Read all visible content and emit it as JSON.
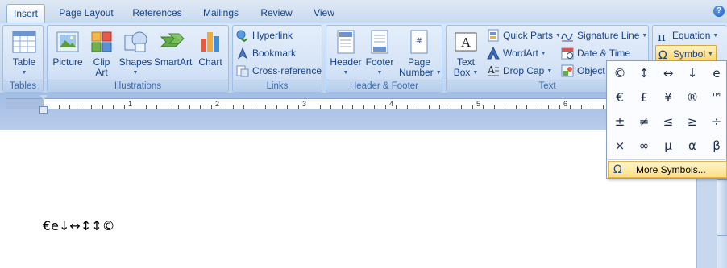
{
  "tabs": [
    {
      "label": "Insert",
      "active": true
    },
    {
      "label": "Page Layout"
    },
    {
      "label": "References"
    },
    {
      "label": "Mailings"
    },
    {
      "label": "Review"
    },
    {
      "label": "View"
    }
  ],
  "help_label": "?",
  "groups": {
    "tables": {
      "label": "Tables",
      "table_label": "Table"
    },
    "illustrations": {
      "label": "Illustrations",
      "picture": "Picture",
      "clip_art_1": "Clip",
      "clip_art_2": "Art",
      "shapes": "Shapes",
      "smartart": "SmartArt",
      "chart": "Chart"
    },
    "links": {
      "label": "Links",
      "hyperlink": "Hyperlink",
      "bookmark": "Bookmark",
      "cross_reference": "Cross-reference"
    },
    "header_footer": {
      "label": "Header & Footer",
      "header": "Header",
      "footer": "Footer",
      "page_number_1": "Page",
      "page_number_2": "Number"
    },
    "text": {
      "label": "Text",
      "text_box_1": "Text",
      "text_box_2": "Box",
      "quick_parts": "Quick Parts",
      "wordart": "WordArt",
      "drop_cap": "Drop Cap",
      "signature_line": "Signature Line",
      "date_time": "Date & Time",
      "object": "Object"
    },
    "symbols": {
      "equation": "Equation",
      "symbol": "Symbol"
    }
  },
  "ruler": {
    "numbers": [
      "1",
      "2",
      "3",
      "4",
      "5",
      "6"
    ]
  },
  "document": {
    "text": "€e↓↔↕↕©"
  },
  "symbol_popup": {
    "symbols": [
      "©",
      "↕",
      "↔",
      "↓",
      "e",
      "€",
      "£",
      "¥",
      "®",
      "™",
      "±",
      "≠",
      "≤",
      "≥",
      "÷",
      "×",
      "∞",
      "µ",
      "α",
      "β"
    ],
    "more_symbols": "More Symbols..."
  }
}
